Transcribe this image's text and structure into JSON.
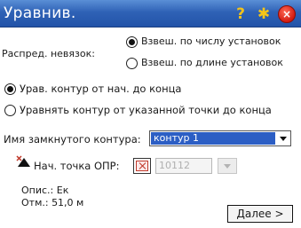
{
  "title": "Уравнив.",
  "titlebar_icons": {
    "help": "question-mark",
    "favorite": "star",
    "close": "close-x"
  },
  "distribution": {
    "label": "Распред. невязок:",
    "options": [
      {
        "label": "Взвеш. по числу установок",
        "selected": true
      },
      {
        "label": "Взвеш. по длине установок",
        "selected": false
      }
    ]
  },
  "adjust_mode": {
    "options": [
      {
        "label": "Урав. контур от нач. до конца",
        "selected": true
      },
      {
        "label": "Уравнять контур от указанной точки до конца",
        "selected": false
      }
    ]
  },
  "loop_name": {
    "label": "Имя замкнутого контура:",
    "value": "контур 1"
  },
  "start_point": {
    "label": "Нач. точка ОПР:",
    "value": "10112",
    "description": "Опис.: Ек",
    "elevation": "Отм.: 51,0 м"
  },
  "next_label": "Далее >",
  "colors": {
    "titlebar": "#2f62b6",
    "selection": "#2c5ec4",
    "close_button": "#d21a10"
  }
}
